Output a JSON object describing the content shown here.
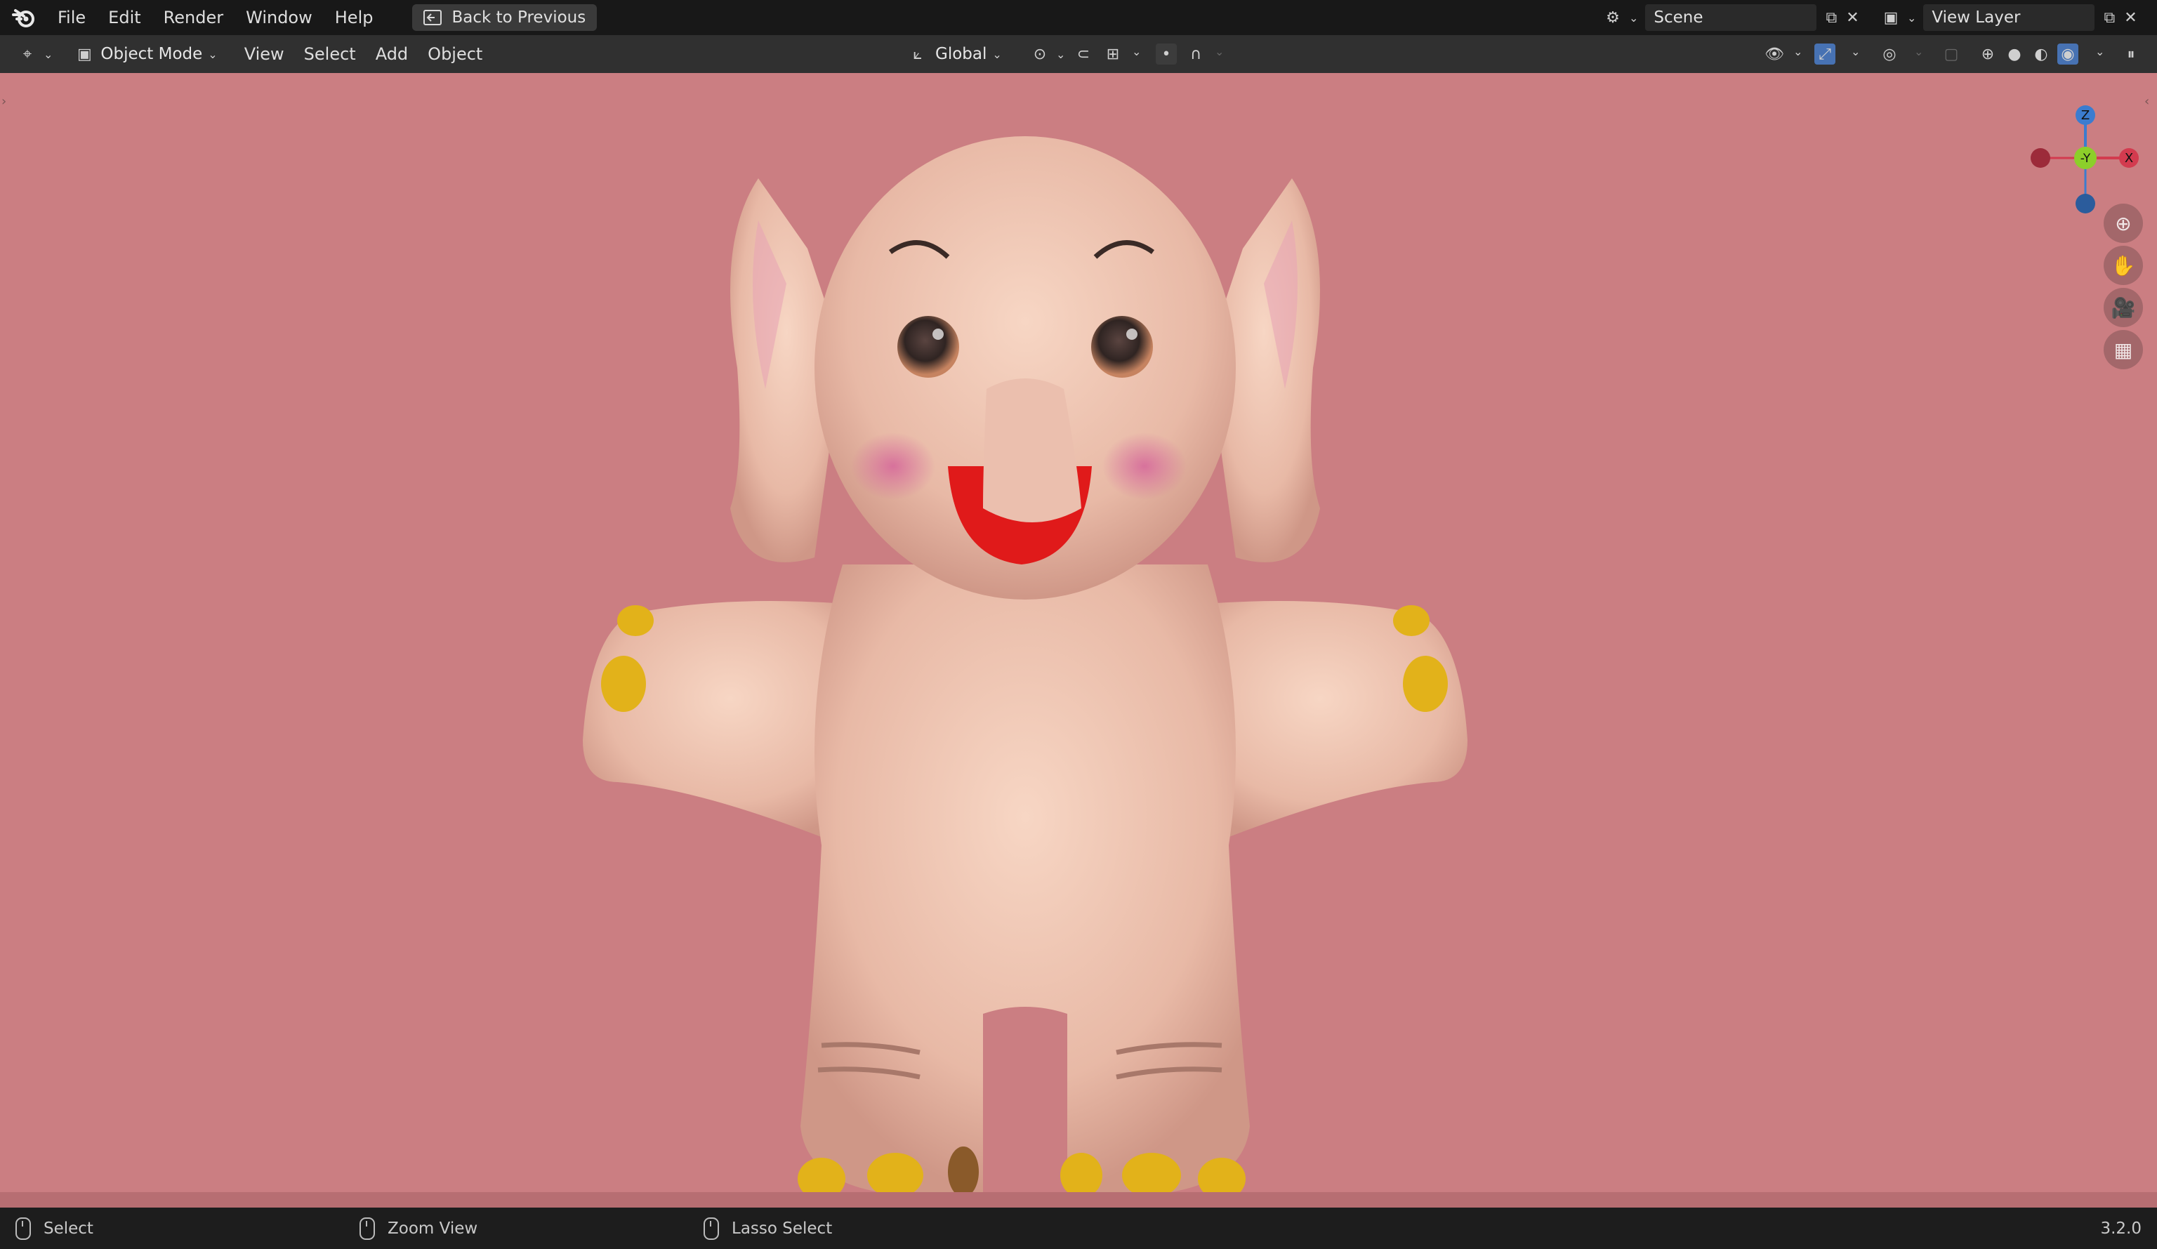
{
  "topbar": {
    "menus": [
      "File",
      "Edit",
      "Render",
      "Window",
      "Help"
    ],
    "back_button": "Back to Previous",
    "scene_name": "Scene",
    "view_layer_name": "View Layer"
  },
  "header": {
    "mode": "Object Mode",
    "menus": [
      "View",
      "Select",
      "Add",
      "Object"
    ],
    "transform_orientation": "Global"
  },
  "viewport": {
    "background_color": "#cb7e82",
    "gizmo_axes": [
      "Z",
      "-Y",
      "X"
    ],
    "nav_buttons": [
      "zoom-icon",
      "hand-pan-icon",
      "camera-icon",
      "grid-icon"
    ]
  },
  "statusbar": {
    "left_click": "Select",
    "middle_click": "Zoom View",
    "right_click": "Lasso Select",
    "version": "3.2.0"
  }
}
